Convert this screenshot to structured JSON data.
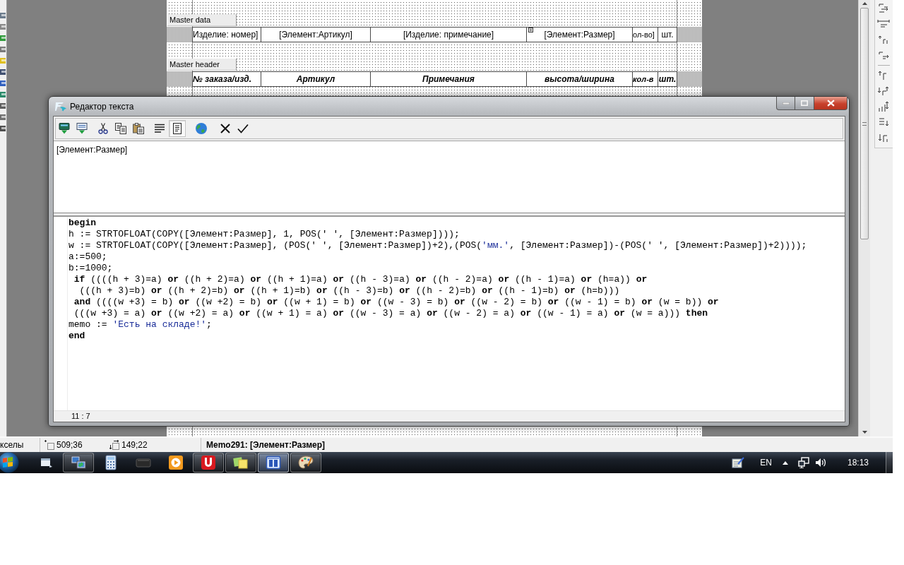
{
  "report_designer": {
    "bands": [
      {
        "kind": "data",
        "label": "Master data",
        "cells": [
          {
            "text": "Изделие: номер]",
            "marker": false
          },
          {
            "text": "[Элемент:Артикул]",
            "marker": false
          },
          {
            "text": "[Изделие: примечание]",
            "marker": false
          },
          {
            "text": "[Элемент:Размер]",
            "marker": true
          },
          {
            "text": "ол-во]",
            "marker": false
          },
          {
            "text": "шт.",
            "marker": false
          }
        ]
      },
      {
        "kind": "header",
        "label": "Master header",
        "cells": [
          {
            "text": "№ заказа/изд.",
            "marker": false
          },
          {
            "text": "Артикул",
            "marker": false
          },
          {
            "text": "Примечания",
            "marker": false
          },
          {
            "text": "высота/ширина",
            "marker": false
          },
          {
            "text": "кол-в",
            "marker": false
          },
          {
            "text": "шт.",
            "marker": false
          }
        ]
      }
    ]
  },
  "text_editor": {
    "title": "Редактор текста",
    "toolbar_groups": [
      [
        {
          "pressed": false
        },
        {
          "pressed": false
        }
      ],
      [
        {
          "pressed": false
        },
        {
          "pressed": false
        },
        {
          "pressed": false
        }
      ],
      [
        {
          "pressed": false
        },
        {
          "pressed": true
        }
      ],
      [
        {
          "pressed": false
        }
      ],
      [
        {
          "pressed": false
        },
        {
          "pressed": false
        }
      ]
    ],
    "memo_text": "[Элемент:Размер]",
    "script_lines": [
      {
        "segments": [
          {
            "kind": "code",
            "text": "**begin**"
          }
        ]
      },
      {
        "segments": [
          {
            "kind": "code",
            "text": "h := STRTOFLOAT(COPY([Элемент:Размер], 1, POS(' ', [Элемент:Размер])));"
          }
        ]
      },
      {
        "segments": [
          {
            "kind": "code",
            "text": "w := STRTOFLOAT(COPY([Элемент:Размер], (POS(' ', [Элемент:Размер])+2),(POS("
          },
          {
            "kind": "string",
            "text": "'мм.'"
          },
          {
            "kind": "code",
            "text": ", [Элемент:Размер])-(POS(' ', [Элемент:Размер])+2))));"
          }
        ]
      },
      {
        "segments": [
          {
            "kind": "code",
            "text": "a:=500;"
          }
        ]
      },
      {
        "segments": [
          {
            "kind": "code",
            "text": "b:=1000;"
          }
        ]
      },
      {
        "segments": [
          {
            "kind": "code",
            "text": " **if** ((((h + 3)=a) **or** ((h + 2)=a) **or** ((h + 1)=a) **or** ((h - 3)=a) **or** ((h - 2)=a) **or** ((h - 1)=a) **or** (h=a)) **or**"
          }
        ]
      },
      {
        "segments": [
          {
            "kind": "code",
            "text": "  (((h + 3)=b) **or** ((h + 2)=b) **or** ((h + 1)=b) **or** ((h - 3)=b) **or** ((h - 2)=b) **or** ((h - 1)=b) **or** (h=b)))"
          }
        ]
      },
      {
        "segments": [
          {
            "kind": "code",
            "text": " **and** ((((w +3) = b) **or** ((w +2) = b) **or** ((w + 1) = b) **or** ((w - 3) = b) **or** ((w - 2) = b) **or** ((w - 1) = b) **or** (w = b)) **or**"
          }
        ]
      },
      {
        "segments": [
          {
            "kind": "code",
            "text": " (((w +3) = a) **or** ((w +2) = a) **or** ((w + 1) = a) **or** ((w - 3) = a) **or** ((w - 2) = a) **or** ((w - 1) = a) **or** (w = a))) **then**"
          }
        ]
      },
      {
        "segments": [
          {
            "kind": "code",
            "text": "memo := "
          },
          {
            "kind": "string",
            "text": "'Есть на складе!'"
          },
          {
            "kind": "code",
            "text": ";"
          }
        ]
      },
      {
        "segments": [
          {
            "kind": "code",
            "text": "**end**"
          }
        ]
      }
    ],
    "cursor_position": "11 : 7"
  },
  "status_bar": {
    "units": "кселы",
    "position": "509;36",
    "size": "149;22",
    "selected_object": "Memo291: [Элемент:Размер]"
  },
  "taskbar": {
    "apps": [
      {
        "running": false,
        "active": false
      },
      {
        "running": true,
        "active": false
      },
      {
        "running": false,
        "active": false
      },
      {
        "running": false,
        "active": false
      },
      {
        "running": false,
        "active": false
      },
      {
        "running": true,
        "active": false
      },
      {
        "running": true,
        "active": false
      },
      {
        "running": true,
        "active": true
      },
      {
        "running": true,
        "active": false
      }
    ],
    "language": "EN",
    "clock": "18:13"
  }
}
